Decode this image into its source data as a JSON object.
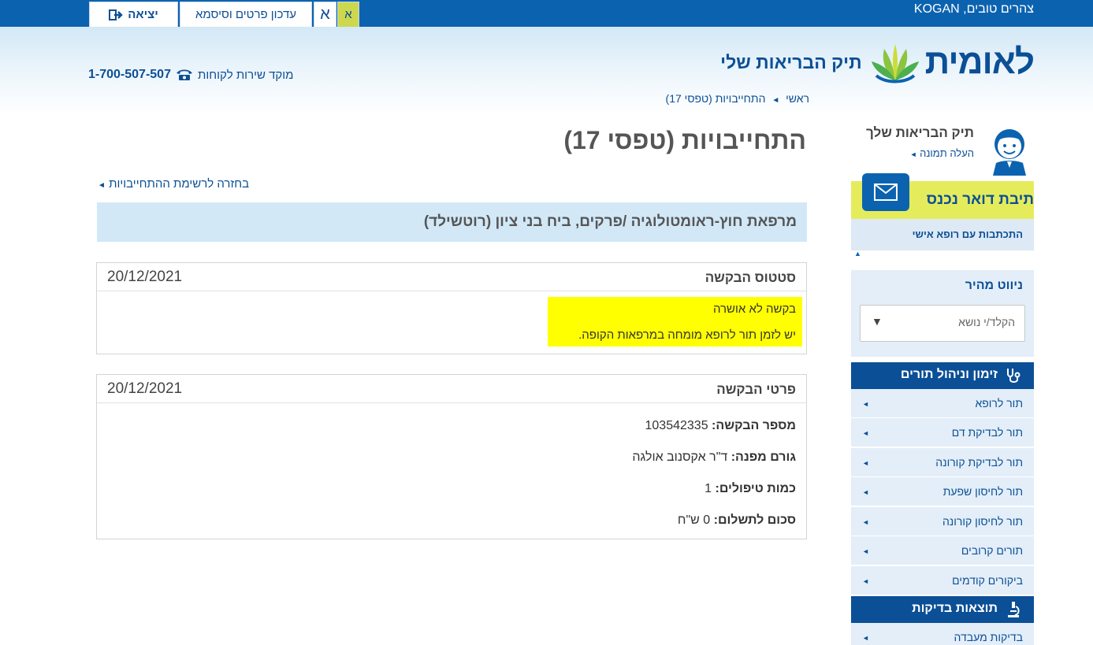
{
  "topbar": {
    "greeting": "צהרים טובים, KOGAN",
    "exit_label": "יציאה",
    "update_label": "עדכון פרטים וסיסמא",
    "font_large": "א",
    "font_small": "א"
  },
  "header": {
    "logo_name": "לאומית",
    "logo_sub": "תיק הבריאות שלי",
    "phone_label": "מוקד שירות לקוחות",
    "phone_number": "1-700-507-507",
    "breadcrumb": [
      "ראשי",
      "התחייבויות (טפסי 17)"
    ]
  },
  "sidebar": {
    "profile_title": "תיק הבריאות שלך",
    "profile_link": "העלה תמונה",
    "mail_title": "תיבת דואר נכנס",
    "mail_sub": "התכתבות עם רופא אישי",
    "quick_title": "ניווט מהיר",
    "quick_placeholder": "הקלד/י נושא",
    "appointments_title": "זימון וניהול תורים",
    "appointments_items": [
      "תור לרופא",
      "תור לבדיקת דם",
      "תור לבדיקת קורונה",
      "תור לחיסון שפעת",
      "תור לחיסון קורונה",
      "תורים קרובים",
      "ביקורים קודמים"
    ],
    "results_title": "תוצאות בדיקות",
    "results_items": [
      "בדיקות מעבדה"
    ]
  },
  "main": {
    "title": "התחייבויות (טפסי 17)",
    "back_link": "בחזרה לרשימת ההתחייבויות",
    "clinic": "מרפאת חוץ-ראומטולוגיה /פרקים, ביח בני ציון (רוטשילד)",
    "status_card": {
      "title": "סטטוס הבקשה",
      "date": "20/12/2021",
      "line1": "בקשה לא אושרה",
      "line2": "יש לזמן תור לרופא מומחה במרפאות הקופה."
    },
    "details_card": {
      "title": "פרטי הבקשה",
      "date": "20/12/2021",
      "request_number_label": "מספר הבקשה:",
      "request_number": "103542335",
      "referrer_label": "גורם מפנה:",
      "referrer": "ד\"ר אקסנוב אולגה",
      "treatments_label": "כמות טיפולים:",
      "treatments": "1",
      "payment_label": "סכום לתשלום:",
      "payment": "0 ש\"ח"
    }
  },
  "colors": {
    "brand_blue": "#0b4f96",
    "topbar_blue": "#0b63b0",
    "accent_yellow": "#e5ec5c",
    "highlight": "#ffff00"
  }
}
